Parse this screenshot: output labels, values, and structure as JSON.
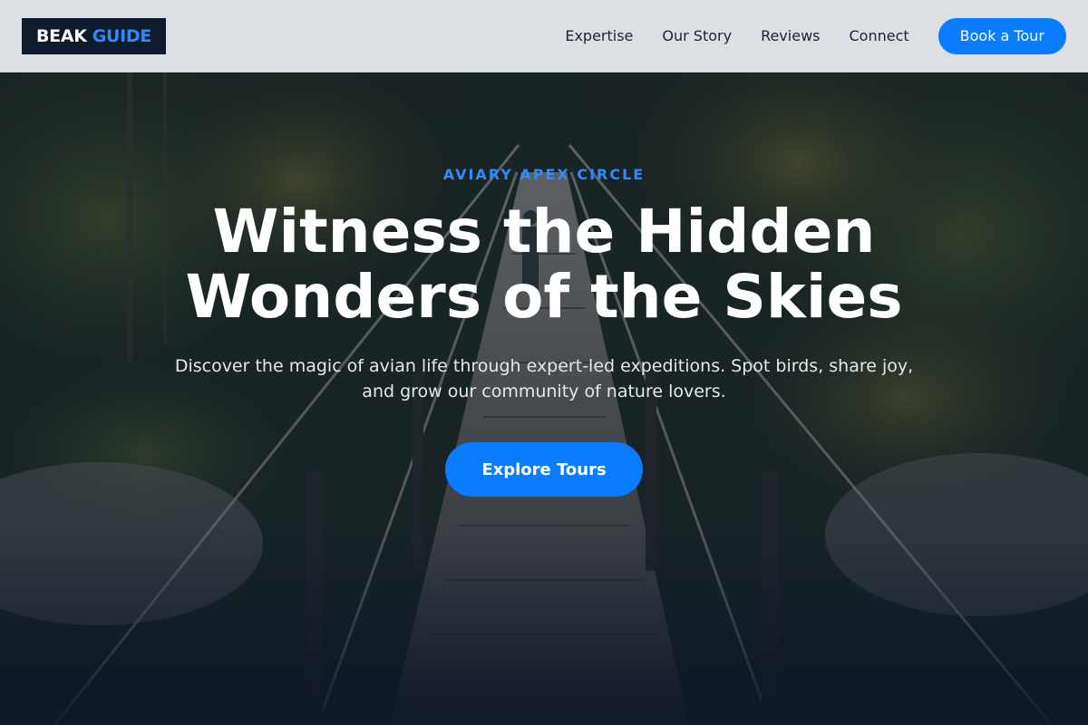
{
  "brand": {
    "word1": "BEAK",
    "word2": "GUIDE"
  },
  "nav": {
    "links": [
      "Expertise",
      "Our Story",
      "Reviews",
      "Connect"
    ],
    "cta_label": "Book a Tour"
  },
  "hero": {
    "eyebrow": "AVIARY APEX CIRCLE",
    "headline": "Witness the Hidden Wonders of the Skies",
    "subhead": "Discover the magic of avian life through expert-led expeditions. Spot birds, share joy, and grow our community of nature lovers.",
    "cta_label": "Explore Tours",
    "background": "forest suspension bridge photo"
  },
  "colors": {
    "accent": "#0a7cff",
    "eyebrow": "#2e8bff",
    "dark": "#0f1a2a",
    "navbar_bg": "#dcdfe3"
  }
}
